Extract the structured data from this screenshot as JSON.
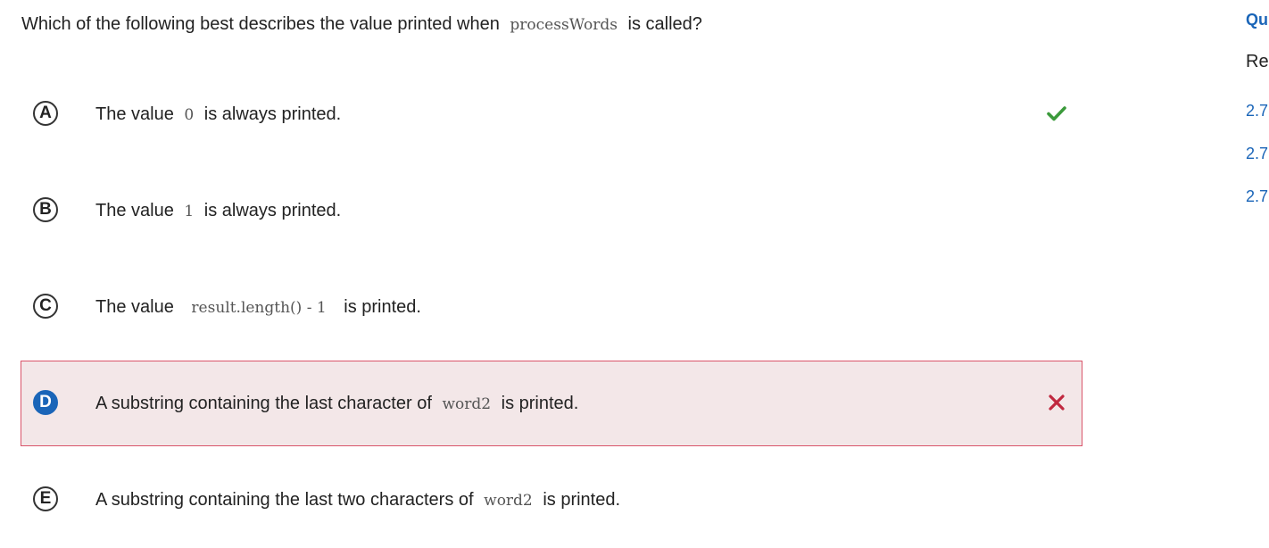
{
  "question": {
    "prefix": "Which of the following best describes the value printed when",
    "code": "processWords",
    "suffix": "is called?"
  },
  "choices": [
    {
      "letter": "A",
      "before": "The value",
      "code": "0",
      "after": "is always printed.",
      "mark": "check-icon",
      "state": "correct"
    },
    {
      "letter": "B",
      "before": "The value",
      "code": "1",
      "after": "is always printed.",
      "mark": "",
      "state": "none"
    },
    {
      "letter": "C",
      "before": "The value",
      "code": "result.length() - 1",
      "after": "is printed.",
      "mark": "",
      "state": "none"
    },
    {
      "letter": "D",
      "before": "A substring containing the last character of",
      "code": "word2",
      "after": "is printed.",
      "mark": "cross-icon",
      "state": "selected-wrong"
    },
    {
      "letter": "E",
      "before": "A substring containing the last two characters of",
      "code": "word2",
      "after": "is printed.",
      "mark": "",
      "state": "none"
    }
  ],
  "sidebar": {
    "heading": "Qu",
    "subheading": "Re",
    "links": [
      "2.7",
      "2.7",
      "2.7"
    ]
  },
  "colors": {
    "correct": "#3b9a3b",
    "incorrect": "#c0283f",
    "selected_bg": "#f3e7e8",
    "selected_border": "#d9546a",
    "link": "#1a65b8"
  }
}
